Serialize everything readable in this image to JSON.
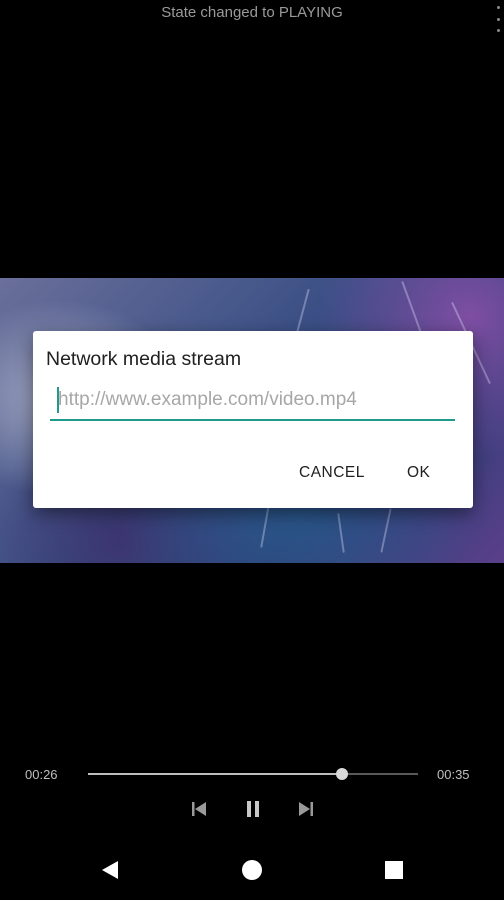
{
  "status": {
    "message": "State changed to PLAYING",
    "menu_icon": "more-vert-icon"
  },
  "dialog": {
    "title": "Network media stream",
    "url_value": "",
    "url_placeholder": "http://www.example.com/video.mp4",
    "cancel_label": "CANCEL",
    "ok_label": "OK",
    "accent_color": "#1e9a8a"
  },
  "player": {
    "current_time": "00:26",
    "total_time": "00:35",
    "progress_fraction": 0.77,
    "prev_icon": "skip-previous-icon",
    "pause_icon": "pause-icon",
    "next_icon": "skip-next-icon"
  },
  "navbar": {
    "back_icon": "back-triangle-icon",
    "home_icon": "home-circle-icon",
    "recents_icon": "recents-square-icon"
  }
}
